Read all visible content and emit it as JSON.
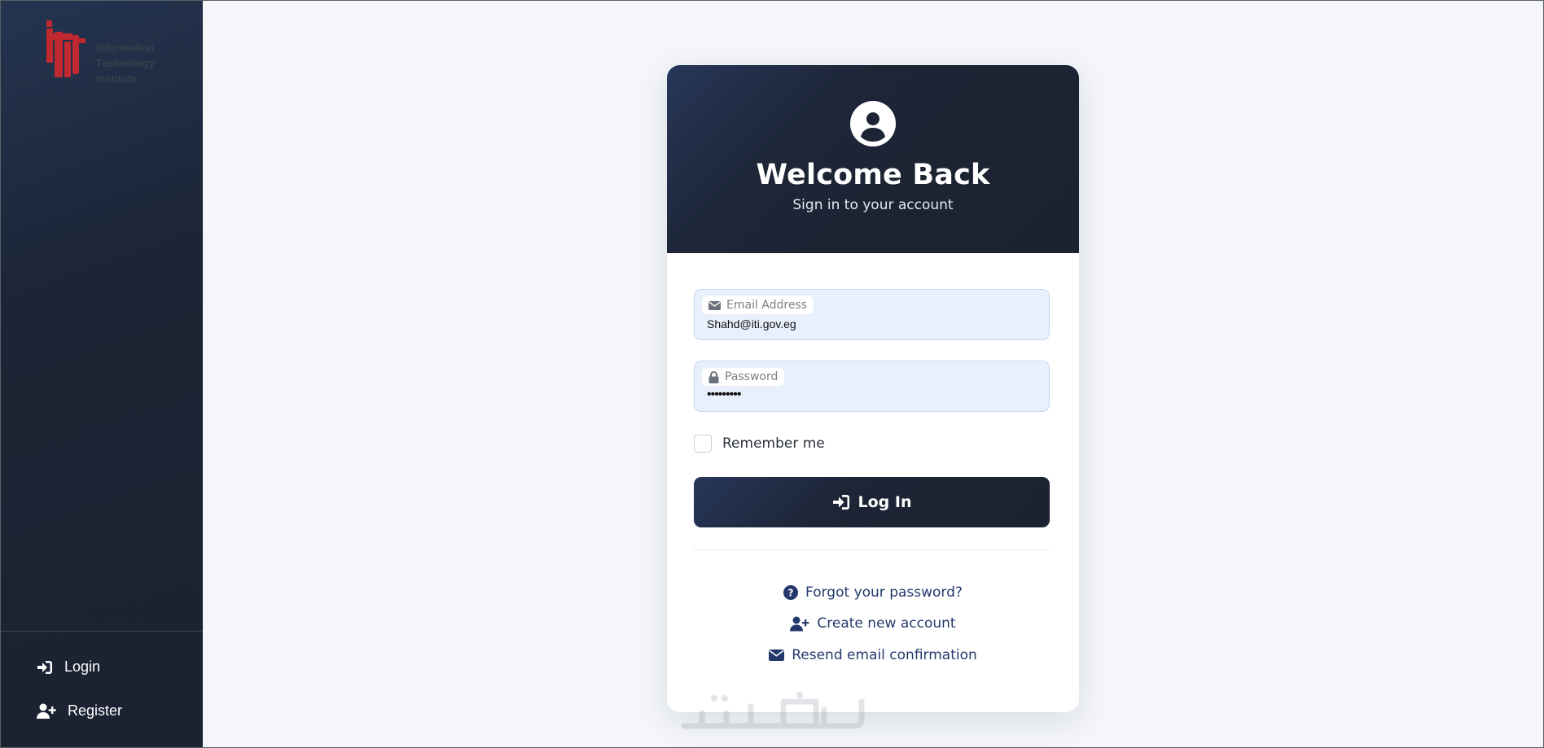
{
  "sidebar": {
    "logo_lines": [
      "Information",
      "Technology",
      "Institute"
    ],
    "nav": [
      {
        "label": "Login",
        "icon": "sign-in-icon"
      },
      {
        "label": "Register",
        "icon": "user-plus-icon"
      }
    ]
  },
  "card": {
    "title": "Welcome Back",
    "subtitle": "Sign in to your account",
    "email": {
      "label": "Email Address",
      "value": "Shahd@iti.gov.eg"
    },
    "password": {
      "label": "Password",
      "value": "•••••••••"
    },
    "remember_label": "Remember me",
    "login_button": "Log In",
    "links": {
      "forgot": "Forgot your password?",
      "create": "Create new account",
      "resend": "Resend email confirmation"
    }
  },
  "colors": {
    "brand_red": "#c0292f",
    "dark_navy": "#1b2231",
    "link_blue": "#24396b",
    "input_bg": "#e8f0fd"
  }
}
